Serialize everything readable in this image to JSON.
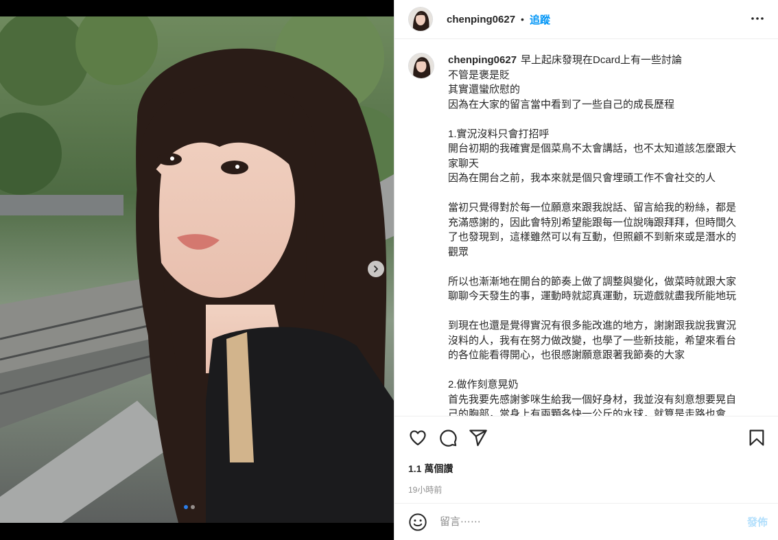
{
  "post": {
    "username": "chenping0627",
    "follow_label": "追蹤",
    "separator": "•",
    "caption_first": "早上起床發現在Dcard上有一些討論",
    "caption_lines": [
      "不管是褒是貶",
      "其實還蠻欣慰的",
      "因為在大家的留言當中看到了一些自己的成長歷程",
      "",
      "1.實況沒料只會打招呼",
      "開台初期的我確實是個菜鳥不太會講話，也不太知道該怎麼跟大",
      "家聊天",
      "因為在開台之前，我本來就是個只會埋頭工作不會社交的人",
      "",
      "當初只覺得對於每一位願意來跟我說話、留言給我的粉絲，都是",
      "充滿感謝的，因此會特別希望能跟每一位說嗨跟拜拜，但時間久",
      "了也發現到，這樣雖然可以有互動，但照顧不到新來或是潛水的",
      "觀眾",
      "",
      "所以也漸漸地在開台的節奏上做了調整與變化，做菜時就跟大家",
      "聊聊今天發生的事，運動時就認真運動，玩遊戲就盡我所能地玩",
      "",
      "到現在也還是覺得實況有很多能改進的地方，謝謝跟我說我實況",
      "沒料的人，我有在努力做改變，也學了一些新技能，希望來看台",
      "的各位能看得開心，也很感謝願意跟著我節奏的大家",
      "",
      "2.做作刻意晃奶",
      "首先我要先感謝爹咪生給我一個好身材，我並沒有刻意想要晃自",
      "己的胸部，當身上有兩顆各快一公斤的水球，就算是走路也會"
    ],
    "likes": "1.1 萬個讚",
    "time": "19小時前",
    "comment_placeholder": "留言⋯⋯",
    "post_label": "發佈",
    "carousel": {
      "total": 2,
      "current": 1
    }
  },
  "icons": {
    "more": "more-horizontal-icon",
    "like": "heart-icon",
    "comment": "comment-bubble-icon",
    "share": "paper-plane-icon",
    "save": "bookmark-icon",
    "emoji": "smiley-icon",
    "next": "chevron-right-icon"
  },
  "colors": {
    "link": "#0095f6",
    "text": "#262626",
    "muted": "#8e8e8e",
    "post_disabled": "#b2dffc"
  }
}
